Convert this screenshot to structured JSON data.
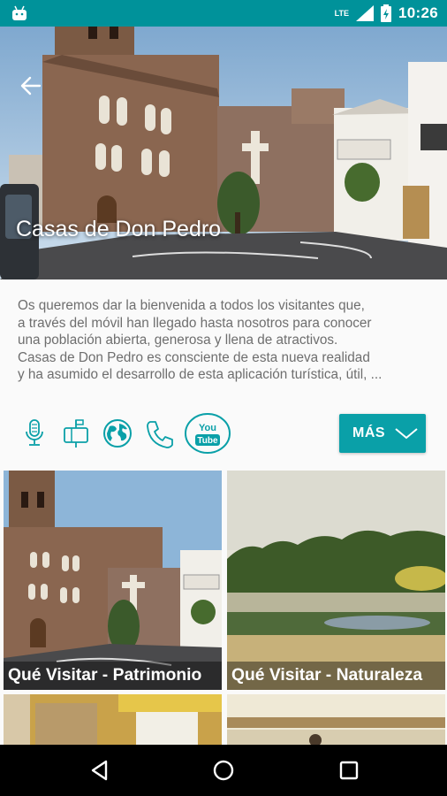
{
  "status_bar": {
    "network": "LTE",
    "time": "10:26",
    "icons": [
      "android-icon",
      "signal-icon",
      "battery-icon"
    ]
  },
  "hero": {
    "title": "Casas de Don Pedro",
    "back_icon": "arrow-left-icon"
  },
  "description": {
    "lines": [
      "Os queremos dar la bienvenida a todos los visitantes que,",
      "a través del móvil han llegado hasta nosotros para conocer",
      "una población abierta, generosa y llena de atractivos.",
      "Casas de Don Pedro es consciente de esta nueva realidad",
      "y ha asumido el desarrollo de esta aplicación turística, útil, ..."
    ]
  },
  "actions": {
    "icons": [
      "microphone-icon",
      "mailbox-icon",
      "globe-icon",
      "phone-icon",
      "youtube-icon"
    ],
    "youtube_top": "You",
    "youtube_bottom": "Tube",
    "more_label": "MÁS",
    "more_icon": "chevron-down-icon"
  },
  "tiles": [
    {
      "caption": "Qué Visitar - Patrimonio"
    },
    {
      "caption": "Qué Visitar - Naturaleza"
    }
  ],
  "nav_bar": {
    "icons": [
      "back-triangle-icon",
      "home-circle-icon",
      "recents-square-icon"
    ]
  },
  "colors": {
    "status_bar": "#00929a",
    "accent": "#0aa0a8",
    "text": "#6e6e6e"
  }
}
